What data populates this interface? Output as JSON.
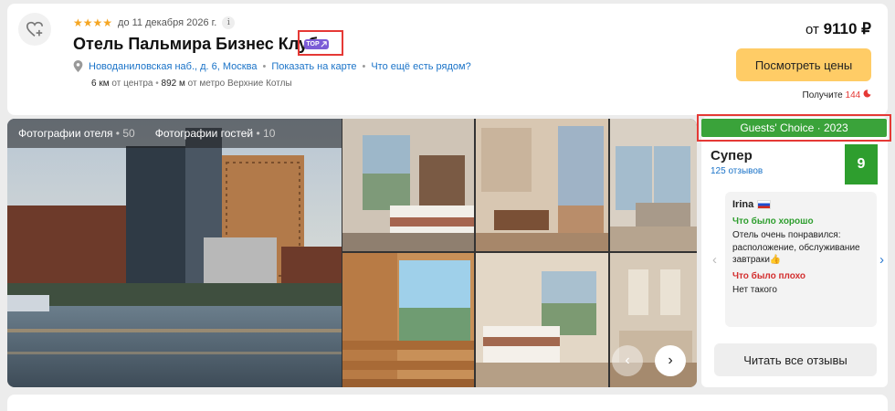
{
  "hotel": {
    "stars": "★★★★",
    "stars_note": "до 11 декабря 2026 г.",
    "info_icon": "i",
    "name": "Отель Пальмира Бизнес Клуб",
    "top_badge": "TOP",
    "address": "Новоданиловская наб., д. 6, Москва",
    "map_link": "Показать на карте",
    "nearby_link": "Что ещё есть рядом?",
    "center_dist_value": "6 км",
    "center_dist_label": "от центра",
    "metro_dist_value": "892 м",
    "metro_dist_label": "от метро Верхние Котлы"
  },
  "pricing": {
    "prefix": "от",
    "amount": "9110 ₽",
    "cta_label": "Посмотреть цены",
    "reward_label": "Получите",
    "reward_value": "144"
  },
  "gallery": {
    "tabs": [
      {
        "label": "Фотографии отеля",
        "count": "50"
      },
      {
        "label": "Фотографии гостей",
        "count": "10"
      }
    ],
    "prev_icon": "‹",
    "next_icon": "›"
  },
  "reviews": {
    "badge": "Guests' Choice · 2023",
    "rating_word": "Супер",
    "rating_count": "125 отзывов",
    "score": "9",
    "reviewer": "Irina",
    "good_label": "Что было хорошо",
    "good_text": "Отель очень понравился: расположение, обслуживание завтраки👍",
    "bad_label": "Что было плохо",
    "bad_text": "Нет такого",
    "read_all": "Читать все отзывы",
    "prev_icon": "‹",
    "next_icon": "›"
  },
  "colors": {
    "accent_link": "#1a73c8",
    "cta": "#ffcc66",
    "score_green": "#2e9e2e",
    "highlight_red": "#e53935"
  }
}
